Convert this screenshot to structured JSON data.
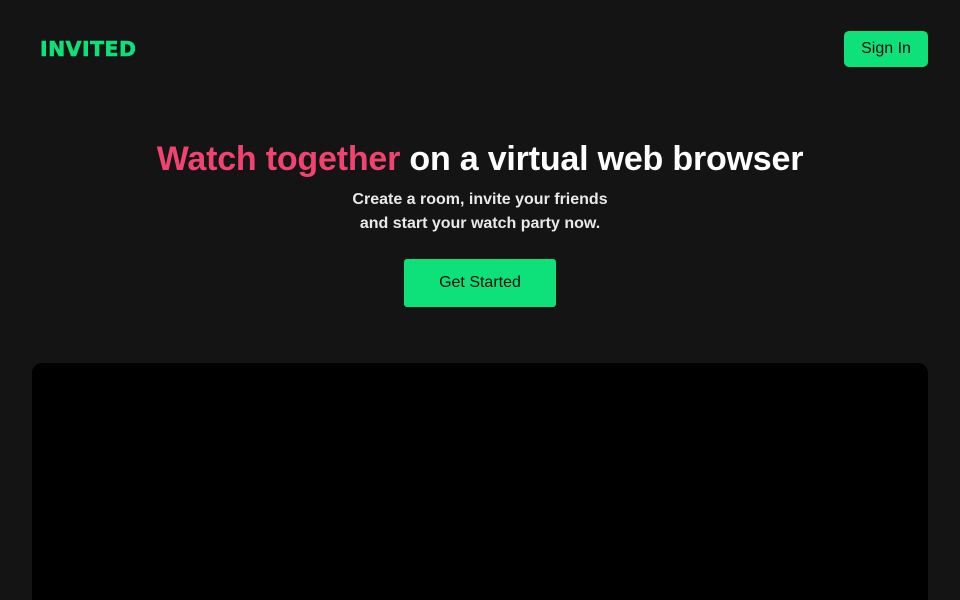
{
  "header": {
    "logo_text": "INVITED",
    "sign_in_label": "Sign In"
  },
  "hero": {
    "headline_accent": "Watch together",
    "headline_rest": " on a virtual web browser",
    "subline_1": "Create a room, invite your friends",
    "subline_2": "and start your watch party now.",
    "cta_label": "Get Started"
  },
  "colors": {
    "background": "#141414",
    "brand_green": "#0ee17a",
    "accent_pink": "#f0436f",
    "preview_black": "#000000"
  }
}
